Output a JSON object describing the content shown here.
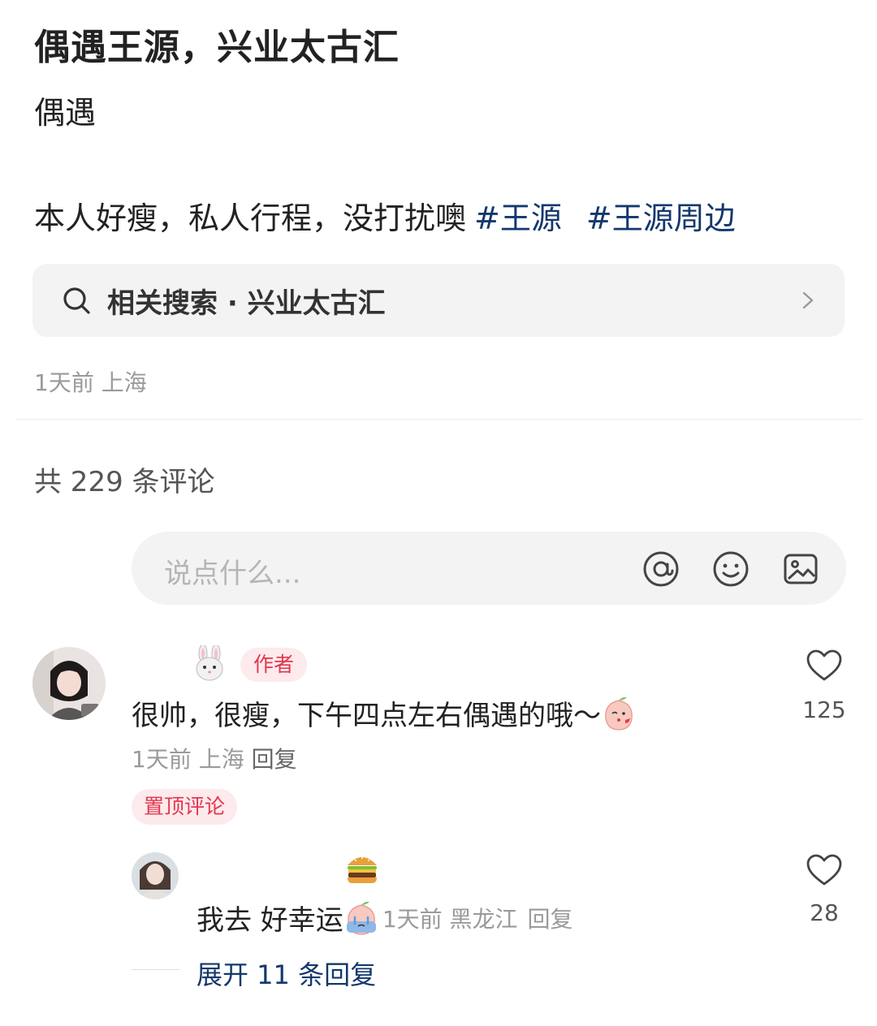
{
  "post": {
    "title": "偶遇王源，兴业太古汇",
    "subtitle": "偶遇",
    "body": "本人好瘦，私人行程，没打扰噢",
    "tags": [
      "#王源",
      "#王源周边"
    ],
    "related_search": "相关搜索 · 兴业太古汇",
    "meta": "1天前 上海"
  },
  "comments_header": {
    "count_text": "共 229 条评论",
    "input_placeholder": "说点什么..."
  },
  "icons": {
    "search": "search-icon",
    "chevron": "chevron-right-icon",
    "at": "at-icon",
    "emoji": "smile-icon",
    "image": "image-icon",
    "heart": "heart-icon"
  },
  "comments": [
    {
      "badge": "作者",
      "text": "很帅，很瘦，下午四点左右偶遇的哦～",
      "meta": "1天前 上海",
      "reply_label": "回复",
      "likes": "125",
      "pinned_label": "置顶评论"
    },
    {
      "text": "我去 好幸运",
      "meta": "1天前 黑龙江",
      "reply_label": "回复",
      "likes": "28"
    }
  ],
  "expand_replies": "展开 11 条回复",
  "colors": {
    "accent_blue": "#13386c",
    "badge_red": "#e2364d",
    "badge_bg": "#fdeaec",
    "gray_text": "#9a9a9a",
    "box_bg": "#f3f3f3"
  }
}
